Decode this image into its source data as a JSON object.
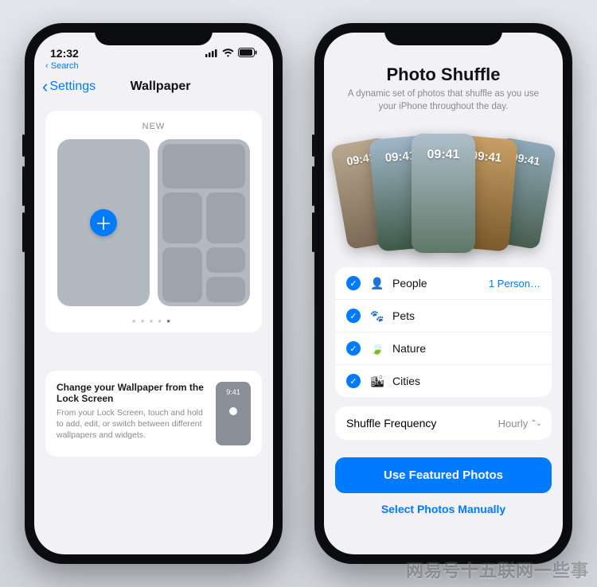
{
  "phoneA": {
    "status": {
      "time": "12:32",
      "back_crumb": "Search"
    },
    "nav": {
      "back_label": "Settings",
      "title": "Wallpaper"
    },
    "new_label": "NEW",
    "tip": {
      "heading": "Change your Wallpaper from the Lock Screen",
      "body": "From your Lock Screen, touch and hold to add, edit, or switch between different wallpapers and widgets.",
      "preview_time": "9:41"
    }
  },
  "phoneB": {
    "title": "Photo Shuffle",
    "subtitle": "A dynamic set of photos that shuffle as you use your iPhone throughout the day.",
    "preview_time": "09:41",
    "categories": [
      {
        "icon": "person-icon",
        "glyph": "👤",
        "label": "People",
        "trailing": "1 Person…"
      },
      {
        "icon": "pets-icon",
        "glyph": "🐾",
        "label": "Pets",
        "trailing": ""
      },
      {
        "icon": "nature-icon",
        "glyph": "🍃",
        "label": "Nature",
        "trailing": ""
      },
      {
        "icon": "cities-icon",
        "glyph": "🏙",
        "label": "Cities",
        "trailing": ""
      }
    ],
    "frequency": {
      "label": "Shuffle Frequency",
      "value": "Hourly"
    },
    "primary_cta": "Use Featured Photos",
    "secondary_cta": "Select Photos Manually"
  },
  "watermark": "网易号十五联网一些事"
}
